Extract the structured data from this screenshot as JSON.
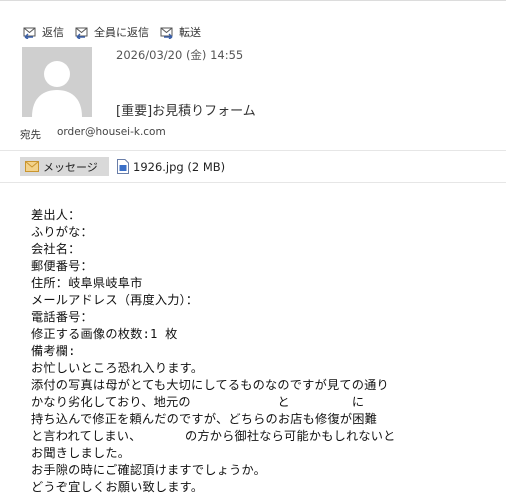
{
  "actions": {
    "reply": "返信",
    "reply_all": "全員に返信",
    "forward": "転送"
  },
  "message": {
    "date": "2026/03/20 (金) 14:55",
    "subject": "[重要]お見積りフォーム",
    "to_label": "宛先",
    "to_address": "order@housei-k.com"
  },
  "tabs": {
    "message_label": "メッセージ",
    "attachment_label": "1926.jpg (2 MB)"
  },
  "body_lines": [
    "差出人：",
    "ふりがな：",
    "会社名：",
    "郵便番号：",
    "住所：岐阜県岐阜市",
    "メールアドレス（再度入力）：",
    "電話番号：",
    "修正する画像の枚数:1 枚",
    "備考欄:",
    "お忙しいところ恐れ入ります。",
    "添付の写真は母がとても大切にしてるものなのですが見ての通り",
    "かなり劣化しており、地元の　　　　　　　と　　　　　に",
    "持ち込んで修正を頼んだのですが、どちらのお店も修復が困難",
    "と言われてしまい、　　　　の方から御社なら可能かもしれないと",
    "お聞きしました。",
    "お手隙の時にご確認頂けますでしょうか。",
    "どうぞ宜しくお願い致します。"
  ],
  "colors": {
    "icon_blue": "#3a5fa8",
    "avatar_bg": "#cfcfcf",
    "tab_bg": "#d9d9d9",
    "envelope": "#e0b04a"
  }
}
